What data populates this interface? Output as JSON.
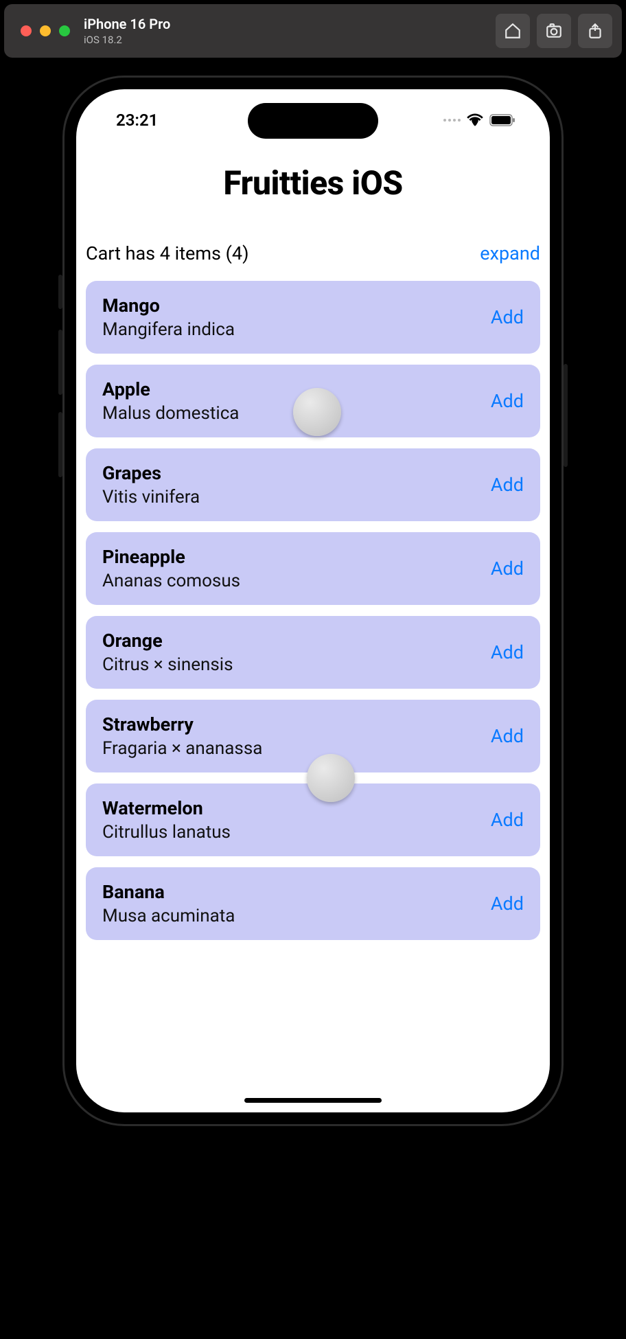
{
  "simulator": {
    "device_name": "iPhone 16 Pro",
    "os_version": "iOS 18.2"
  },
  "status_bar": {
    "time": "23:21"
  },
  "app": {
    "title": "Fruitties iOS"
  },
  "cart": {
    "label": "Cart has 4 items (4)",
    "expand_label": "expand"
  },
  "add_label": "Add",
  "fruits": [
    {
      "name": "Mango",
      "latin": "Mangifera indica"
    },
    {
      "name": "Apple",
      "latin": "Malus domestica"
    },
    {
      "name": "Grapes",
      "latin": "Vitis vinifera"
    },
    {
      "name": "Pineapple",
      "latin": "Ananas comosus"
    },
    {
      "name": "Orange",
      "latin": "Citrus × sinensis"
    },
    {
      "name": "Strawberry",
      "latin": "Fragaria × ananassa"
    },
    {
      "name": "Watermelon",
      "latin": "Citrullus lanatus"
    },
    {
      "name": "Banana",
      "latin": "Musa acuminata"
    }
  ]
}
